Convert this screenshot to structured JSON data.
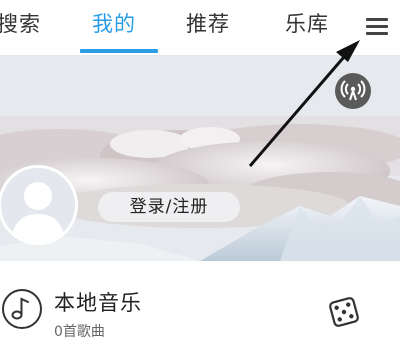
{
  "tabs": [
    {
      "label": "搜索"
    },
    {
      "label": "我的",
      "active": true
    },
    {
      "label": "推荐"
    },
    {
      "label": "乐库"
    }
  ],
  "menu": {
    "icon": "hamburger-menu-icon"
  },
  "banner": {
    "radio_icon": "broadcast-signal-icon",
    "login_label": "登录/注册"
  },
  "local_music": {
    "title": "本地音乐",
    "count_label": "0首歌曲",
    "icon": "music-note-icon",
    "shuffle_icon": "dice-icon"
  },
  "colors": {
    "accent": "#2b9de6",
    "text": "#333333"
  }
}
